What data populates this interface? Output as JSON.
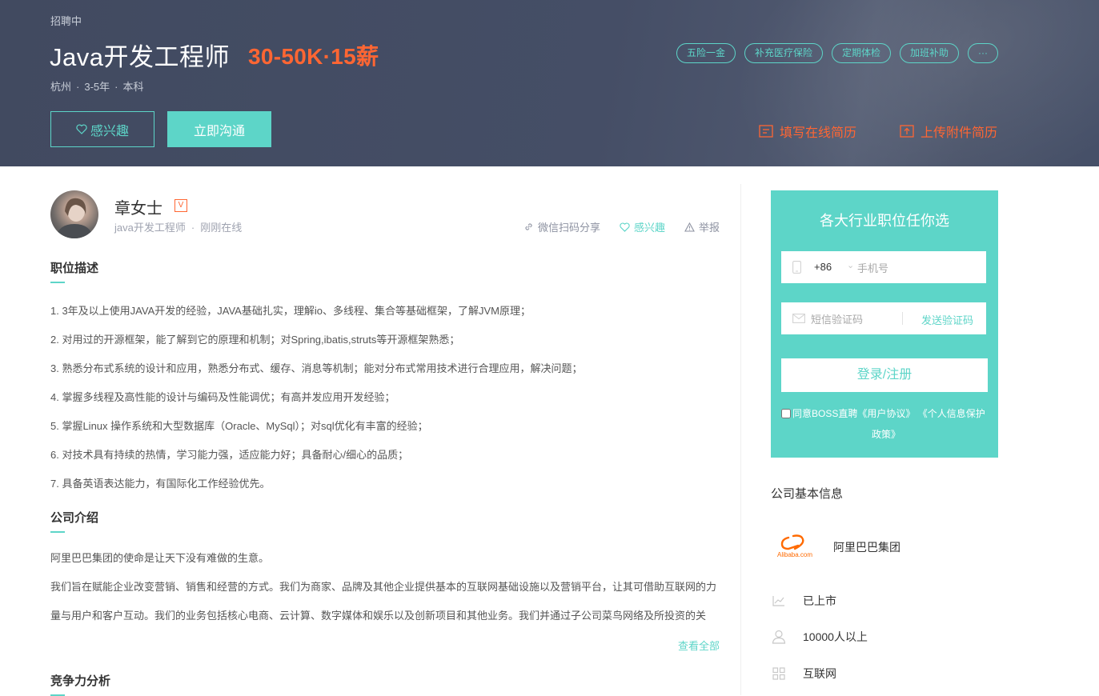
{
  "header": {
    "status": "招聘中",
    "title": "Java开发工程师",
    "salary": "30-50K·15薪",
    "location": "杭州",
    "experience": "3-5年",
    "education": "本科",
    "tags": [
      "五险一金",
      "补充医疗保险",
      "定期体检",
      "加班补助",
      "···"
    ],
    "interest_label": "感兴趣",
    "chat_label": "立即沟通",
    "fill_resume_label": "填写在线简历",
    "upload_resume_label": "上传附件简历"
  },
  "recruiter": {
    "name": "章女士",
    "badge": "V",
    "position": "java开发工程师",
    "online_status": "刚刚在线",
    "share_label": "微信扫码分享",
    "interest_label": "感兴趣",
    "report_label": "举报"
  },
  "description": {
    "title": "职位描述",
    "lines": [
      "1. 3年及以上使用JAVA开发的经验，JAVA基础扎实，理解io、多线程、集合等基础框架，了解JVM原理；",
      "2. 对用过的开源框架，能了解到它的原理和机制；对Spring,ibatis,struts等开源框架熟悉；",
      "3. 熟悉分布式系统的设计和应用，熟悉分布式、缓存、消息等机制；能对分布式常用技术进行合理应用，解决问题；",
      "4. 掌握多线程及高性能的设计与编码及性能调优；有高并发应用开发经验；",
      "5. 掌握Linux 操作系统和大型数据库（Oracle、MySql）；对sql优化有丰富的经验；",
      "6. 对技术具有持续的热情，学习能力强，适应能力好；具备耐心/细心的品质；",
      "7. 具备英语表达能力，有国际化工作经验优先。"
    ]
  },
  "company_intro": {
    "title": "公司介绍",
    "para1": "阿里巴巴集团的使命是让天下没有难做的生意。",
    "para2": "我们旨在赋能企业改变营销、销售和经营的方式。我们为商家、品牌及其他企业提供基本的互联网基础设施以及营销平台，让其可借助互联网的力量与用户和客户互动。我们的业务包括核心电商、云计算、数字媒体和娱乐以及创新项目和其他业务。我们并通过子公司菜鸟网络及所投资的关",
    "see_all_label": "查看全部"
  },
  "competition": {
    "title": "竞争力分析"
  },
  "login": {
    "title": "各大行业职位任你选",
    "country_code": "+86",
    "phone_placeholder": "手机号",
    "sms_placeholder": "短信验证码",
    "send_code_label": "发送验证码",
    "login_label": "登录/注册",
    "agree_prefix": "同意BOSS直聘",
    "agreement_user": "《用户协议》",
    "agreement_privacy_1": "《个人信息保护",
    "agreement_privacy_2": "政策》"
  },
  "company_info": {
    "title": "公司基本信息",
    "logo_text": "Alibaba.com",
    "name": "阿里巴巴集团",
    "stage": "已上市",
    "size": "10000人以上",
    "industry": "互联网"
  },
  "colors": {
    "accent": "#5dd5c8",
    "salary": "#ff6633",
    "header_bg": "#434c63"
  }
}
